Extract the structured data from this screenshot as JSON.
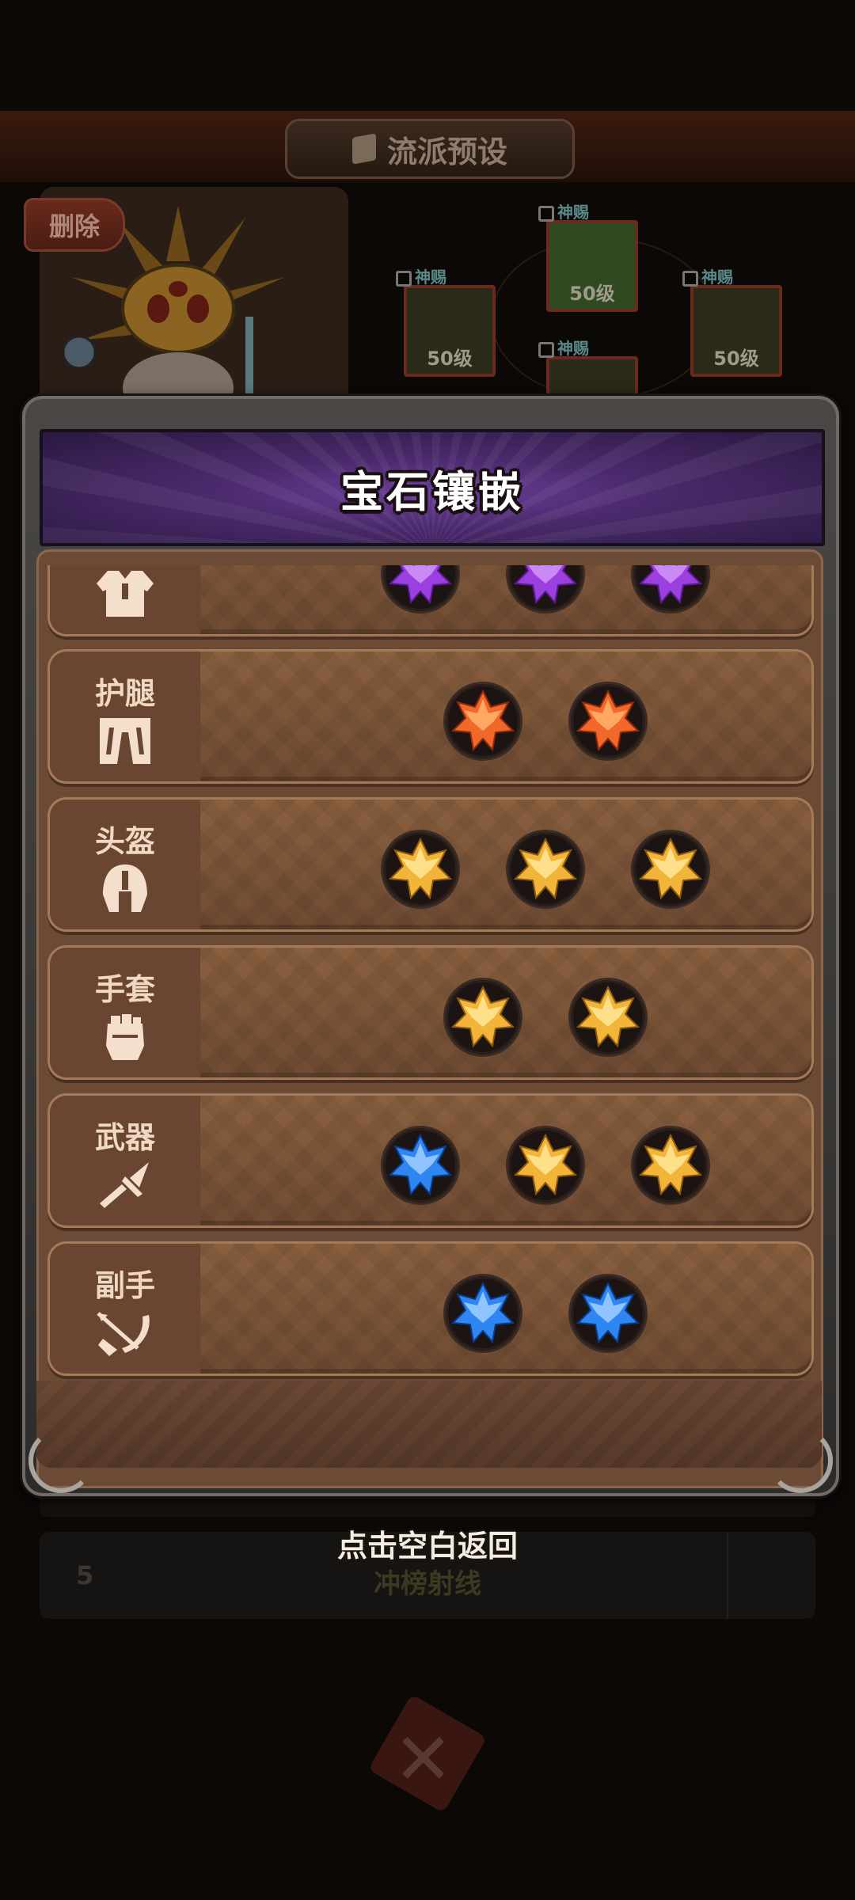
{
  "background": {
    "screen_title": "流派预设",
    "delete_label": "删除",
    "locked_slots": [
      {
        "tag": "神赐",
        "level": "50级"
      },
      {
        "tag": "神赐",
        "level": "50级"
      },
      {
        "tag": "神赐",
        "level": "50级"
      },
      {
        "tag": "神赐",
        "level": ""
      }
    ],
    "preset_row": {
      "number": "5",
      "name": "冲榜射线"
    }
  },
  "modal": {
    "title": "宝石镶嵌",
    "rows": [
      {
        "label": "",
        "icon": "armor-icon",
        "gems": [
          "purple",
          "purple",
          "purple"
        ]
      },
      {
        "label": "护腿",
        "icon": "leg-guard-icon",
        "gems": [
          "orange",
          "orange"
        ]
      },
      {
        "label": "头盔",
        "icon": "helmet-icon",
        "gems": [
          "gold",
          "gold",
          "gold"
        ]
      },
      {
        "label": "手套",
        "icon": "glove-icon",
        "gems": [
          "gold",
          "gold"
        ]
      },
      {
        "label": "武器",
        "icon": "sword-icon",
        "gems": [
          "blue",
          "gold",
          "gold"
        ]
      },
      {
        "label": "副手",
        "icon": "bow-icon",
        "gems": [
          "blue",
          "blue"
        ]
      }
    ]
  },
  "hint": "点击空白返回",
  "colors": {
    "purple": "#9b3fe0",
    "orange": "#f2672a",
    "gold": "#f2b53a",
    "blue": "#2f86f0"
  }
}
